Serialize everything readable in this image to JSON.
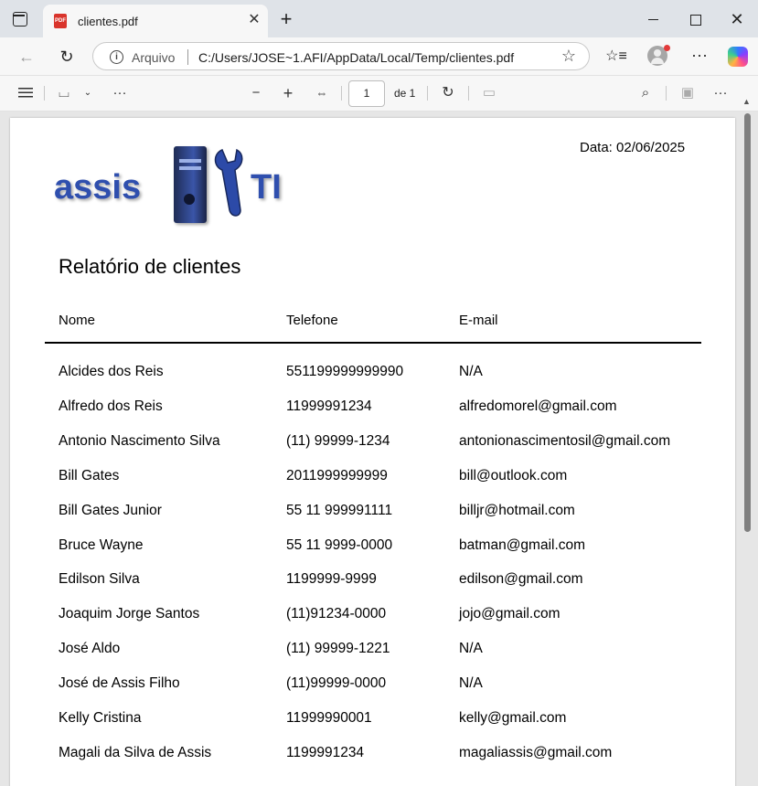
{
  "browser": {
    "tab_title": "clientes.pdf",
    "pdf_badge": "PDF",
    "scheme_label": "Arquivo",
    "url": "C:/Users/JOSE~1.AFI/AppData/Local/Temp/clientes.pdf"
  },
  "pdf_toolbar": {
    "page_number": "1",
    "page_of": "de 1"
  },
  "document": {
    "logo_text_left": "assis",
    "logo_text_right": "TI",
    "date": "Data: 02/06/2025",
    "title": "Relatório de clientes",
    "columns": [
      "Nome",
      "Telefone",
      "E-mail"
    ],
    "rows": [
      [
        "Alcides dos Reis",
        "551199999999990",
        "N/A"
      ],
      [
        "Alfredo dos Reis",
        "11999991234",
        "alfredomorel@gmail.com"
      ],
      [
        "Antonio Nascimento Silva",
        "(11) 99999-1234",
        "antonionascimentosil@gmail.com"
      ],
      [
        "Bill Gates",
        "2011999999999",
        "bill@outlook.com"
      ],
      [
        "Bill Gates Junior",
        "55 11 999991111",
        "billjr@hotmail.com"
      ],
      [
        "Bruce Wayne",
        "55 11 9999-0000",
        "batman@gmail.com"
      ],
      [
        "Edilson Silva",
        "1199999-9999",
        "edilson@gmail.com"
      ],
      [
        "Joaquim  Jorge Santos",
        "(11)91234-0000",
        "jojo@gmail.com"
      ],
      [
        "José Aldo",
        "(11) 99999-1221",
        "N/A"
      ],
      [
        "José de Assis Filho",
        "(11)99999-0000",
        "N/A"
      ],
      [
        "Kelly Cristina",
        "11999990001",
        "kelly@gmail.com"
      ],
      [
        "Magali da Silva de Assis",
        "1199991234",
        "magaliassis@gmail.com"
      ]
    ]
  }
}
